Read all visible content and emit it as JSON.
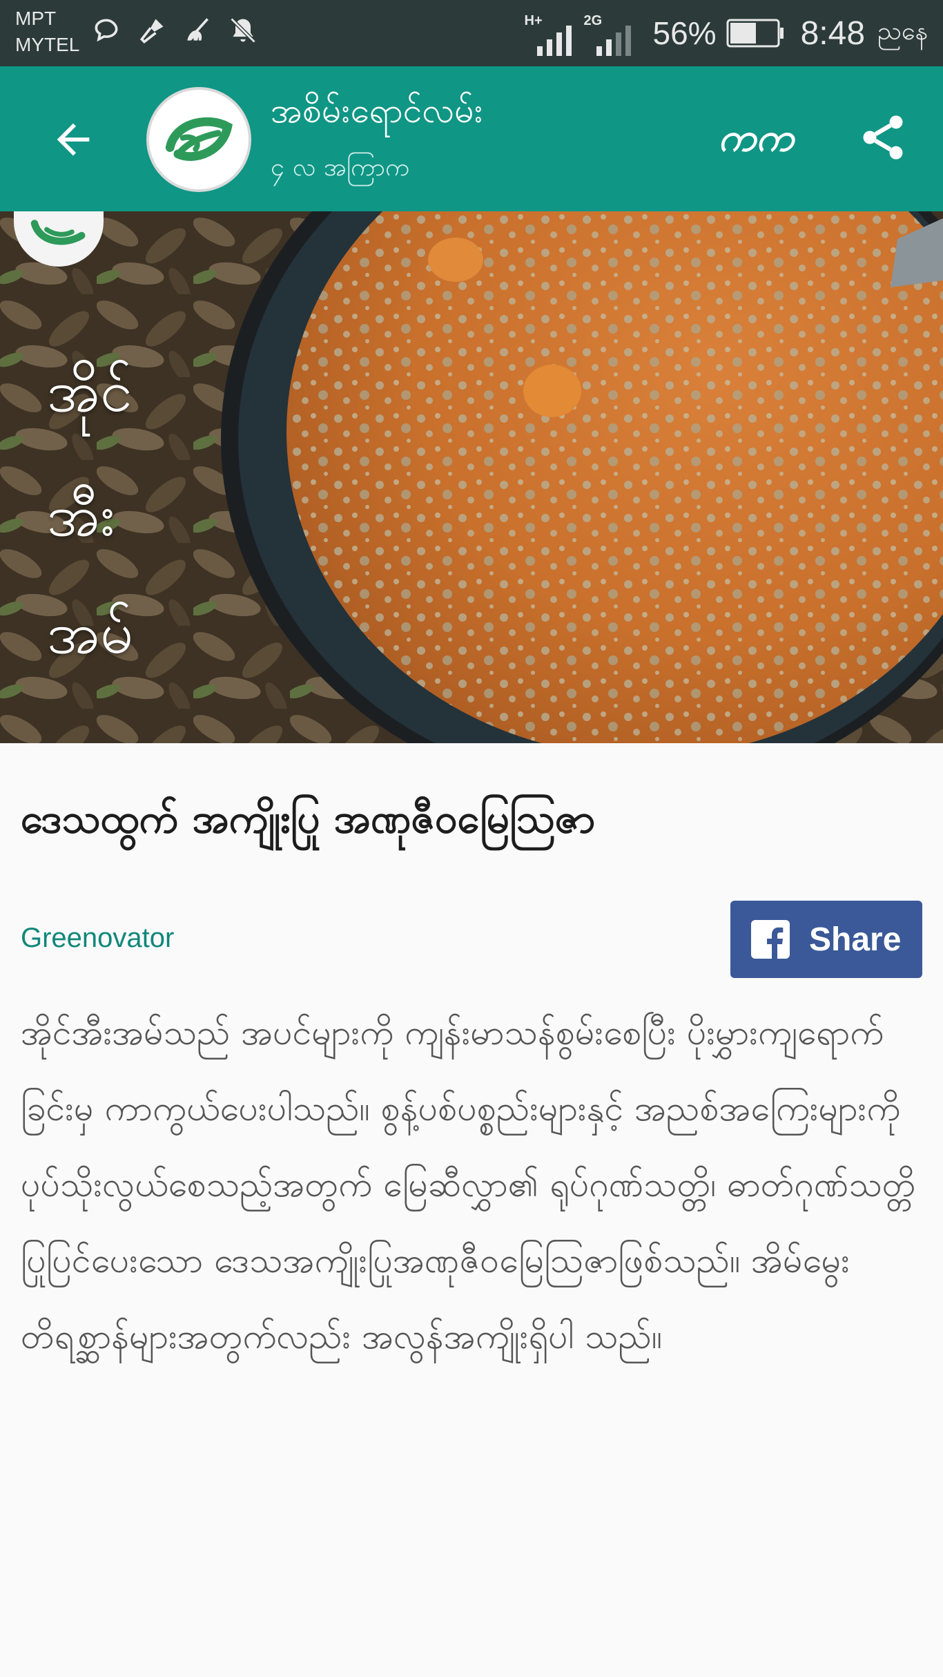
{
  "status_bar": {
    "carrier_1": "MPT",
    "carrier_2": "MYTEL",
    "left_icons": [
      "chat-bubble-icon",
      "microphone-icon",
      "broom-icon",
      "bell-muted-icon"
    ],
    "signal_1_tag": "H+",
    "signal_2_tag": "2G",
    "battery_percent": "56%",
    "battery_level": 0.56,
    "time": "8:48",
    "period": "ညနေ"
  },
  "app_bar": {
    "back_icon": "arrow-back-icon",
    "logo_icon": "leaf-logo-icon",
    "title": "အစိမ်းရောင်လမ်း",
    "subtitle": "၄ လ အကြာက",
    "font_toggle": "ကက",
    "share_icon": "share-icon",
    "color": "#0f9685"
  },
  "hero": {
    "line_1": "အိုင်",
    "line_2": "အီး",
    "line_3": "အမ်"
  },
  "article": {
    "title": "ဒေသထွက် အကျိုးပြု အဏုဇီဝမြေဩဇာ",
    "author": "Greenovator",
    "share_label": "Share",
    "share_icon": "facebook-icon",
    "share_color": "#3b5998",
    "body": "အိုင်အီးအမ်သည် အပင်များကို ကျန်းမာသန်စွမ်းစေပြီး ပိုးမွှားကျရောက်ခြင်းမှ ကာကွယ်ပေးပါသည်။ စွန့်ပစ်ပစ္စည်းများနှင့် အညစ်အကြေးများကို ပုပ်သိုးလွယ်စေသည့်အတွက် မြေဆီလွှာ၏ ရုပ်ဂုဏ်သတ္တိ၊ ဓာတ်ဂုဏ်သတ္တိ ပြုပြင်ပေးသော ဒေသအကျိုးပြုအဏုဇီဝမြေဩဇာဖြစ်သည်။ အိမ်မွေးတိရစ္ဆာန်များအတွက်လည်း အလွန်အကျိုးရှိပါ သည်။"
  }
}
